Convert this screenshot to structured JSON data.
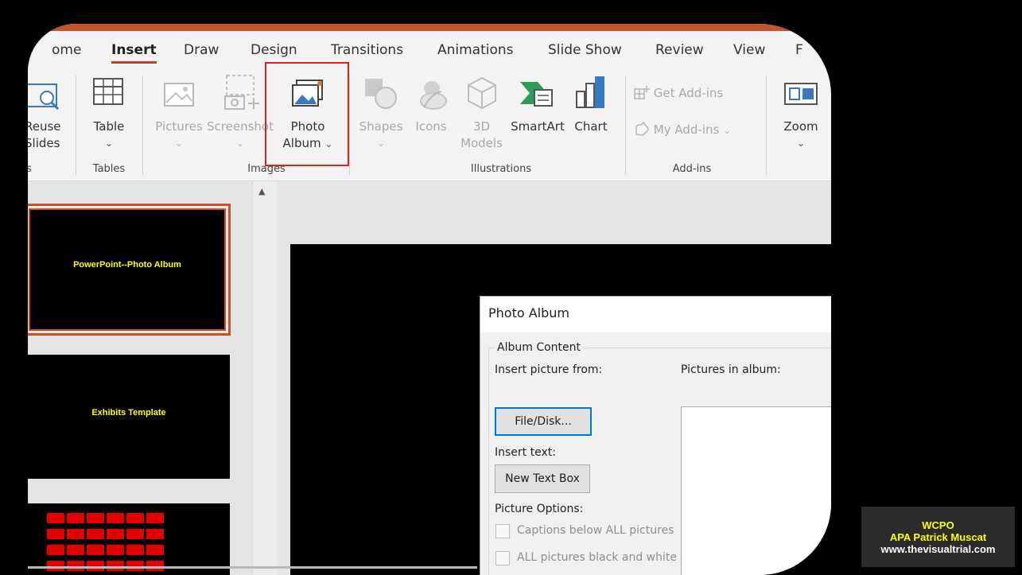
{
  "tabs": [
    "ome",
    "Insert",
    "Draw",
    "Design",
    "Transitions",
    "Animations",
    "Slide Show",
    "Review",
    "View",
    "F"
  ],
  "active_tab": "Insert",
  "ribbon": {
    "reuse": {
      "line1": "Reuse",
      "line2": "Slides"
    },
    "table": {
      "label": "Table",
      "chevron": "⌄"
    },
    "pictures": {
      "label": "Pictures",
      "chevron": "⌄"
    },
    "screenshot": {
      "label": "Screenshot",
      "chevron": "⌄"
    },
    "photo_album": {
      "line1": "Photo",
      "line2": "Album",
      "chevron": "⌄"
    },
    "shapes": {
      "label": "Shapes",
      "chevron": "⌄"
    },
    "icons": {
      "label": "Icons"
    },
    "models": {
      "line1": "3D",
      "line2": "Models"
    },
    "smartart": {
      "label": "SmartArt"
    },
    "chart": {
      "label": "Chart"
    },
    "get_addins": {
      "label": "Get Add-ins"
    },
    "my_addins": {
      "label": "My Add-ins",
      "chevron": "⌄"
    },
    "zoom": {
      "label": "Zoom",
      "chevron": "⌄"
    },
    "groups": {
      "slides": "s",
      "tables": "Tables",
      "images": "Images",
      "illustrations": "Illustrations",
      "addins": "Add-ins"
    }
  },
  "slides": [
    {
      "title": "PowerPoint--Photo Album"
    },
    {
      "title": "Exhibits Template"
    }
  ],
  "scroll_arrow": "▲",
  "dialog": {
    "title": "Photo Album",
    "album_content": "Album Content",
    "insert_picture_from": "Insert picture from:",
    "file_disk_button": "File/Disk...",
    "insert_text": "Insert text:",
    "new_text_box_button": "New Text Box",
    "picture_options": "Picture Options:",
    "captions_option": "Captions below ALL pictures",
    "bw_option": "ALL pictures black and white",
    "pictures_in_album": "Pictures in album:"
  },
  "watermark": {
    "line1": "WCPO",
    "line2": "APA Patrick Muscat",
    "line3": "www.thevisualtrial.com"
  },
  "colors": {
    "accent": "#c4532c",
    "highlight": "#e0201e",
    "watermark_yellow": "#ffff00",
    "slide_text": "#ffff00"
  }
}
